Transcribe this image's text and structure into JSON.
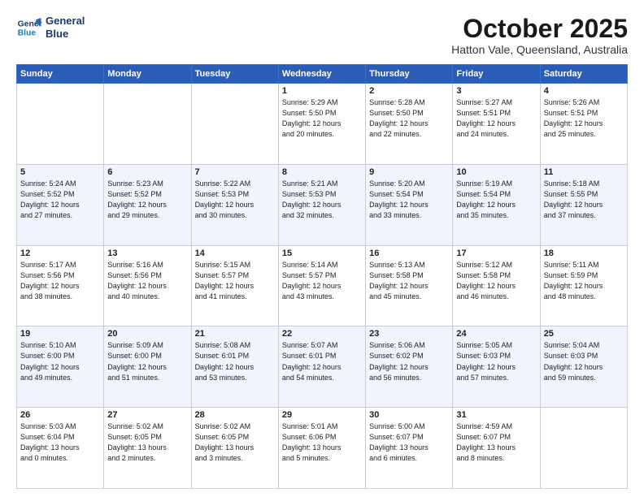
{
  "header": {
    "logo_line1": "General",
    "logo_line2": "Blue",
    "month": "October 2025",
    "location": "Hatton Vale, Queensland, Australia"
  },
  "weekdays": [
    "Sunday",
    "Monday",
    "Tuesday",
    "Wednesday",
    "Thursday",
    "Friday",
    "Saturday"
  ],
  "weeks": [
    [
      {
        "day": "",
        "info": ""
      },
      {
        "day": "",
        "info": ""
      },
      {
        "day": "",
        "info": ""
      },
      {
        "day": "1",
        "info": "Sunrise: 5:29 AM\nSunset: 5:50 PM\nDaylight: 12 hours\nand 20 minutes."
      },
      {
        "day": "2",
        "info": "Sunrise: 5:28 AM\nSunset: 5:50 PM\nDaylight: 12 hours\nand 22 minutes."
      },
      {
        "day": "3",
        "info": "Sunrise: 5:27 AM\nSunset: 5:51 PM\nDaylight: 12 hours\nand 24 minutes."
      },
      {
        "day": "4",
        "info": "Sunrise: 5:26 AM\nSunset: 5:51 PM\nDaylight: 12 hours\nand 25 minutes."
      }
    ],
    [
      {
        "day": "5",
        "info": "Sunrise: 5:24 AM\nSunset: 5:52 PM\nDaylight: 12 hours\nand 27 minutes."
      },
      {
        "day": "6",
        "info": "Sunrise: 5:23 AM\nSunset: 5:52 PM\nDaylight: 12 hours\nand 29 minutes."
      },
      {
        "day": "7",
        "info": "Sunrise: 5:22 AM\nSunset: 5:53 PM\nDaylight: 12 hours\nand 30 minutes."
      },
      {
        "day": "8",
        "info": "Sunrise: 5:21 AM\nSunset: 5:53 PM\nDaylight: 12 hours\nand 32 minutes."
      },
      {
        "day": "9",
        "info": "Sunrise: 5:20 AM\nSunset: 5:54 PM\nDaylight: 12 hours\nand 33 minutes."
      },
      {
        "day": "10",
        "info": "Sunrise: 5:19 AM\nSunset: 5:54 PM\nDaylight: 12 hours\nand 35 minutes."
      },
      {
        "day": "11",
        "info": "Sunrise: 5:18 AM\nSunset: 5:55 PM\nDaylight: 12 hours\nand 37 minutes."
      }
    ],
    [
      {
        "day": "12",
        "info": "Sunrise: 5:17 AM\nSunset: 5:56 PM\nDaylight: 12 hours\nand 38 minutes."
      },
      {
        "day": "13",
        "info": "Sunrise: 5:16 AM\nSunset: 5:56 PM\nDaylight: 12 hours\nand 40 minutes."
      },
      {
        "day": "14",
        "info": "Sunrise: 5:15 AM\nSunset: 5:57 PM\nDaylight: 12 hours\nand 41 minutes."
      },
      {
        "day": "15",
        "info": "Sunrise: 5:14 AM\nSunset: 5:57 PM\nDaylight: 12 hours\nand 43 minutes."
      },
      {
        "day": "16",
        "info": "Sunrise: 5:13 AM\nSunset: 5:58 PM\nDaylight: 12 hours\nand 45 minutes."
      },
      {
        "day": "17",
        "info": "Sunrise: 5:12 AM\nSunset: 5:58 PM\nDaylight: 12 hours\nand 46 minutes."
      },
      {
        "day": "18",
        "info": "Sunrise: 5:11 AM\nSunset: 5:59 PM\nDaylight: 12 hours\nand 48 minutes."
      }
    ],
    [
      {
        "day": "19",
        "info": "Sunrise: 5:10 AM\nSunset: 6:00 PM\nDaylight: 12 hours\nand 49 minutes."
      },
      {
        "day": "20",
        "info": "Sunrise: 5:09 AM\nSunset: 6:00 PM\nDaylight: 12 hours\nand 51 minutes."
      },
      {
        "day": "21",
        "info": "Sunrise: 5:08 AM\nSunset: 6:01 PM\nDaylight: 12 hours\nand 53 minutes."
      },
      {
        "day": "22",
        "info": "Sunrise: 5:07 AM\nSunset: 6:01 PM\nDaylight: 12 hours\nand 54 minutes."
      },
      {
        "day": "23",
        "info": "Sunrise: 5:06 AM\nSunset: 6:02 PM\nDaylight: 12 hours\nand 56 minutes."
      },
      {
        "day": "24",
        "info": "Sunrise: 5:05 AM\nSunset: 6:03 PM\nDaylight: 12 hours\nand 57 minutes."
      },
      {
        "day": "25",
        "info": "Sunrise: 5:04 AM\nSunset: 6:03 PM\nDaylight: 12 hours\nand 59 minutes."
      }
    ],
    [
      {
        "day": "26",
        "info": "Sunrise: 5:03 AM\nSunset: 6:04 PM\nDaylight: 13 hours\nand 0 minutes."
      },
      {
        "day": "27",
        "info": "Sunrise: 5:02 AM\nSunset: 6:05 PM\nDaylight: 13 hours\nand 2 minutes."
      },
      {
        "day": "28",
        "info": "Sunrise: 5:02 AM\nSunset: 6:05 PM\nDaylight: 13 hours\nand 3 minutes."
      },
      {
        "day": "29",
        "info": "Sunrise: 5:01 AM\nSunset: 6:06 PM\nDaylight: 13 hours\nand 5 minutes."
      },
      {
        "day": "30",
        "info": "Sunrise: 5:00 AM\nSunset: 6:07 PM\nDaylight: 13 hours\nand 6 minutes."
      },
      {
        "day": "31",
        "info": "Sunrise: 4:59 AM\nSunset: 6:07 PM\nDaylight: 13 hours\nand 8 minutes."
      },
      {
        "day": "",
        "info": ""
      }
    ]
  ]
}
